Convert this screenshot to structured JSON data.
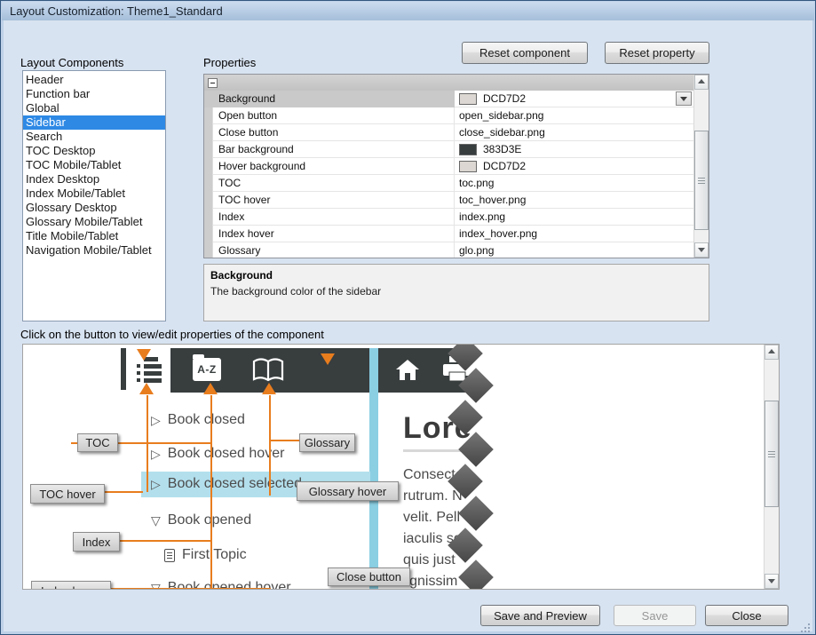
{
  "window": {
    "title": "Layout Customization: Theme1_Standard"
  },
  "components_panel": {
    "label": "Layout Components",
    "selected_index": 3,
    "items": [
      "Header",
      "Function bar",
      "Global",
      "Sidebar",
      "Search",
      "TOC Desktop",
      "TOC Mobile/Tablet",
      "Index Desktop",
      "Index Mobile/Tablet",
      "Glossary Desktop",
      "Glossary Mobile/Tablet",
      "Title Mobile/Tablet",
      "Navigation Mobile/Tablet"
    ]
  },
  "properties_panel": {
    "label": "Properties",
    "buttons": {
      "reset_component": "Reset component",
      "reset_property": "Reset property"
    },
    "grid": {
      "rows": [
        {
          "name": "Background",
          "value": "DCD7D2",
          "swatch": "#DCD7D2",
          "selected": true,
          "dropdown": true
        },
        {
          "name": "Open button",
          "value": "open_sidebar.png"
        },
        {
          "name": "Close button",
          "value": "close_sidebar.png"
        },
        {
          "name": "Bar background",
          "value": "383D3E",
          "swatch": "#383D3E"
        },
        {
          "name": "Hover background",
          "value": "DCD7D2",
          "swatch": "#DCD7D2"
        },
        {
          "name": "TOC",
          "value": "toc.png"
        },
        {
          "name": "TOC hover",
          "value": "toc_hover.png"
        },
        {
          "name": "Index",
          "value": "index.png"
        },
        {
          "name": "Index hover",
          "value": "index_hover.png"
        },
        {
          "name": "Glossary",
          "value": "glo.png"
        }
      ]
    },
    "description": {
      "title": "Background",
      "text": "The background color of the sidebar"
    }
  },
  "preview_panel": {
    "hint": "Click on the button to view/edit properties of the component",
    "toolbar": {
      "az_label": "A-Z"
    },
    "tree": [
      {
        "glyph": "▷",
        "label": "Book closed"
      },
      {
        "glyph": "▷",
        "label": "Book closed hover"
      },
      {
        "glyph": "▷",
        "label": "Book closed selected",
        "selected": true
      },
      {
        "glyph": "▽",
        "label": "Book opened"
      },
      {
        "glyph": "doc",
        "label": "First Topic"
      },
      {
        "glyph": "▽",
        "label": "Book opened hover"
      }
    ],
    "callouts": [
      "TOC",
      "TOC hover",
      "Index",
      "Index hover",
      "Glossary",
      "Glossary hover",
      "Close button"
    ],
    "content": {
      "heading": "Lore",
      "body_lines": [
        "Consecte",
        "rutrum. N",
        "velit. Pell",
        "iaculis so",
        "quis just",
        "lignissim"
      ]
    },
    "colors": {
      "bar_background": "#383D3E",
      "sidebar_background": "#DCD7D2",
      "divider": "#8BCFE3",
      "highlight": "#B3DFEC",
      "annotation": "#E87D1E"
    }
  },
  "footer": {
    "save_and_preview": "Save and Preview",
    "save": "Save",
    "close": "Close"
  }
}
